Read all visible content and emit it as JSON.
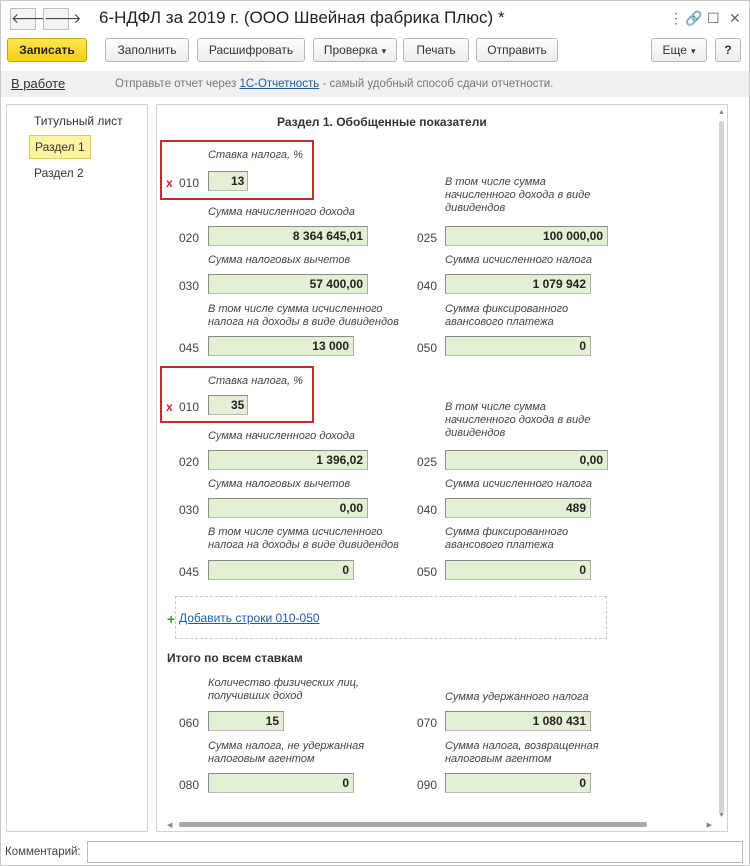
{
  "window": {
    "title": "6-НДФЛ за 2019 г. (ООО Швейная фабрика Плюс) *",
    "back_glyph": "🡐",
    "forward_glyph": "🡒",
    "more_glyph": "⋮",
    "link_glyph": "🔗",
    "max_glyph": "☐",
    "close_glyph": "✕"
  },
  "toolbar": {
    "save": "Записать",
    "fill": "Заполнить",
    "decode": "Расшифровать",
    "check": "Проверка",
    "print": "Печать",
    "send": "Отправить",
    "more": "Еще",
    "help": "?"
  },
  "info": {
    "status": "В работе",
    "text_before": "Отправьте отчет через ",
    "link": "1С-Отчетность",
    "text_after": " - самый удобный способ сдачи отчетности."
  },
  "sidebar": {
    "items": [
      "Титульный лист",
      "Раздел 1",
      "Раздел 2"
    ],
    "active_index": 1
  },
  "section": {
    "title": "Раздел 1. Обобщенные показатели",
    "labels": {
      "rate": "Ставка налога, %",
      "accrued_income": "Сумма начисленного дохода",
      "dividends_income": "В том числе сумма начисленного дохода в виде дивидендов",
      "deductions": "Сумма налоговых вычетов",
      "calculated_tax": "Сумма исчисленного налога",
      "dividends_tax": "В том числе сумма исчисленного налога на доходы в виде дивидендов",
      "fixed_advance": "Сумма фиксированного авансового платежа"
    },
    "marker": "x",
    "rate_blocks": [
      {
        "codes": {
          "rate": "010",
          "accrued": "020",
          "dividends": "025",
          "deductions": "030",
          "tax": "040",
          "div_tax": "045",
          "advance": "050"
        },
        "values": {
          "rate": "13",
          "accrued": "8 364 645,01",
          "dividends": "100 000,00",
          "deductions": "57 400,00",
          "tax": "1 079 942",
          "div_tax": "13 000",
          "advance": "0"
        }
      },
      {
        "codes": {
          "rate": "010",
          "accrued": "020",
          "dividends": "025",
          "deductions": "030",
          "tax": "040",
          "div_tax": "045",
          "advance": "050"
        },
        "values": {
          "rate": "35",
          "accrued": "1 396,02",
          "dividends": "0,00",
          "deductions": "0,00",
          "tax": "489",
          "div_tax": "0",
          "advance": "0"
        }
      }
    ],
    "add_rows": {
      "plus": "+",
      "link": "Добавить строки 010-050"
    },
    "totals": {
      "title": "Итого по всем ставкам",
      "labels": {
        "persons": "Количество физических лиц, получивших доход",
        "withheld": "Сумма удержанного налога",
        "not_withheld": "Сумма налога, не удержанная налоговым агентом",
        "returned": "Сумма налога, возвращенная налоговым агентом"
      },
      "codes": {
        "persons": "060",
        "withheld": "070",
        "not_withheld": "080",
        "returned": "090"
      },
      "values": {
        "persons": "15",
        "withheld": "1 080 431",
        "not_withheld": "0",
        "returned": "0"
      }
    }
  },
  "comment": {
    "label": "Комментарий:",
    "value": ""
  }
}
